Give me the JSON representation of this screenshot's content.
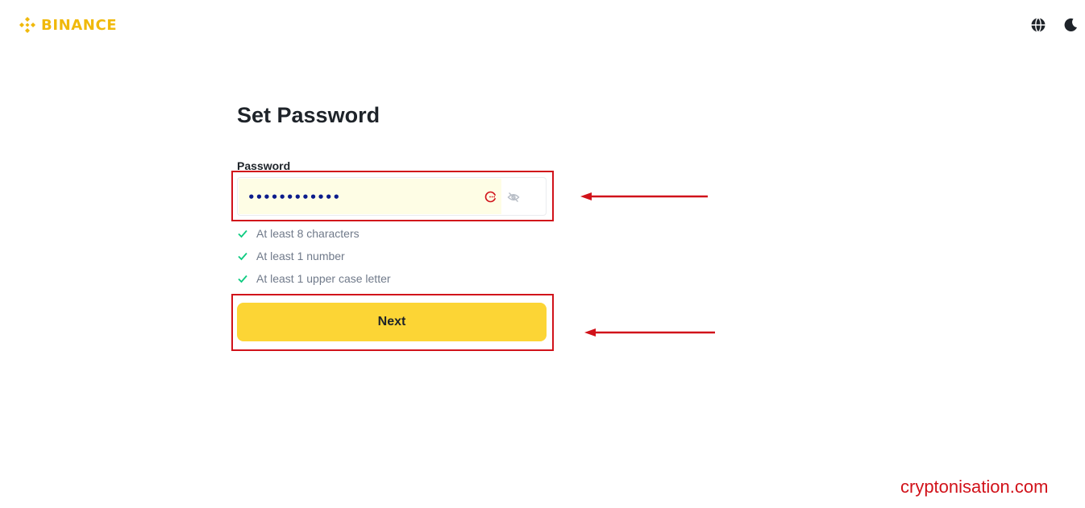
{
  "header": {
    "brand": "BINANCE",
    "icons": [
      "globe-icon",
      "moon-icon"
    ]
  },
  "form": {
    "title": "Set Password",
    "password_label": "Password",
    "password_value": "••••••••••••",
    "rules": [
      {
        "text": "At least 8 characters",
        "met": true
      },
      {
        "text": "At least 1 number",
        "met": true
      },
      {
        "text": "At least 1 upper case letter",
        "met": true
      }
    ],
    "next_label": "Next"
  },
  "colors": {
    "brand": "#f0b90b",
    "button": "#fcd535",
    "check": "#0ecb81",
    "annotation": "#d1121a"
  },
  "watermark": "cryptonisation.com"
}
